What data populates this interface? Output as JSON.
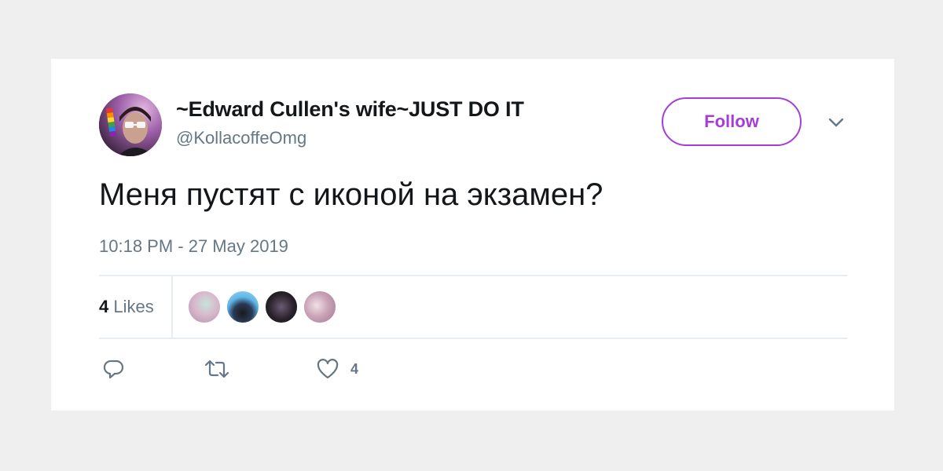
{
  "tweet": {
    "display_name": "~Edward Cullen's wife~JUST DO IT",
    "handle": "@KollacoffeOmg",
    "text": "Меня пустят с иконой на экзамен?",
    "timestamp": "10:18 PM - 27 May 2019"
  },
  "follow_button": {
    "label": "Follow"
  },
  "stats": {
    "likes_count": "4",
    "likes_label": "Likes"
  },
  "actions": {
    "like_count": "4"
  },
  "icons": {
    "menu": "chevron-down-icon",
    "reply": "reply-icon",
    "retweet": "retweet-icon",
    "like": "heart-icon"
  },
  "colors": {
    "accent": "#a53ed6",
    "secondary_text": "#657786",
    "primary_text": "#14171a",
    "background": "#efefef",
    "card": "#ffffff"
  }
}
